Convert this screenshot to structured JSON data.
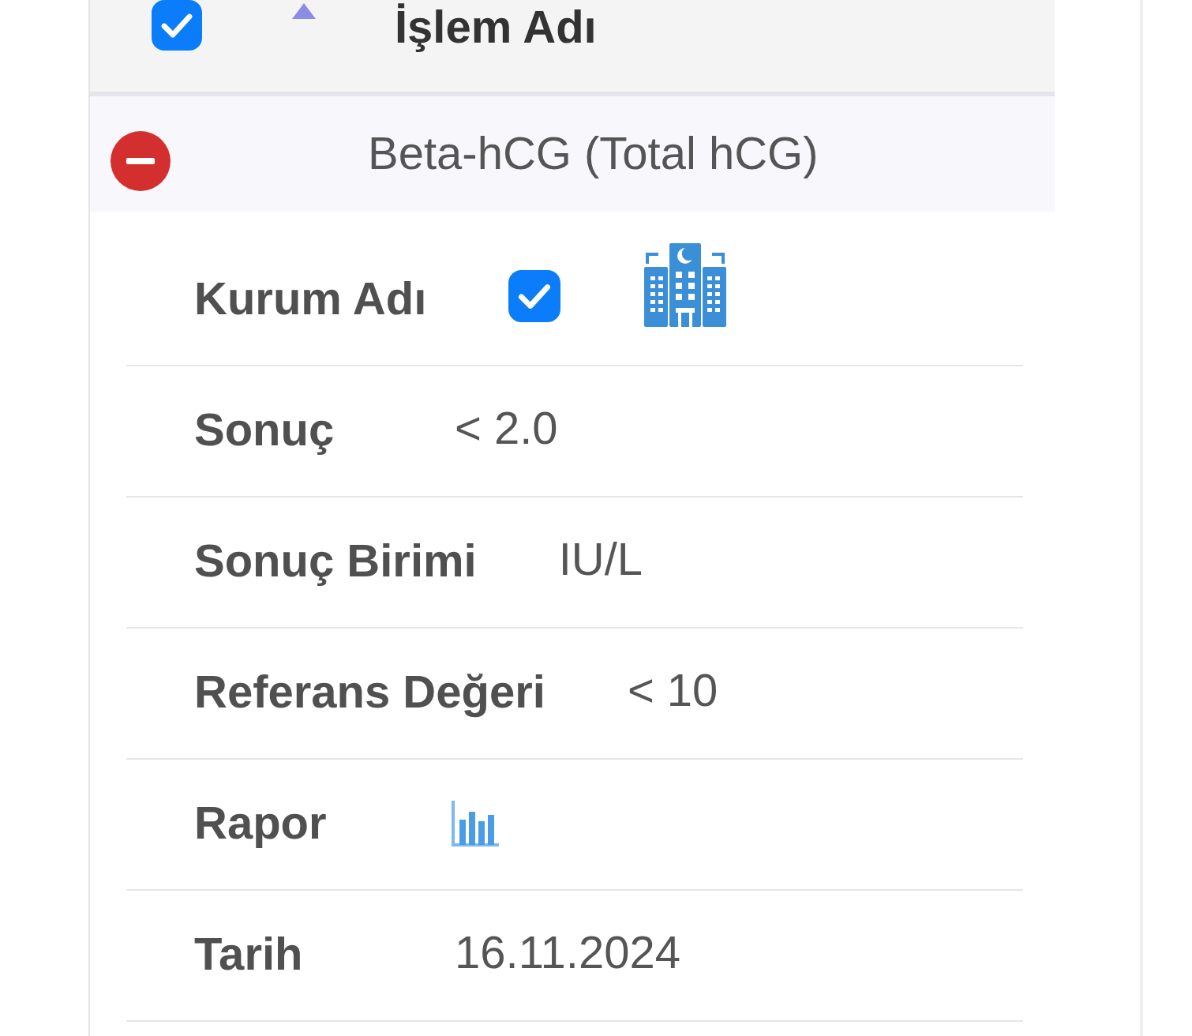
{
  "header": {
    "select_all": {
      "checked": true
    },
    "sort_ascending": true,
    "column": "İşlem Adı"
  },
  "rows": [
    {
      "expanded": true,
      "title": "Beta-hCG (Total hCG)",
      "details": [
        {
          "kind": "institution",
          "label": "Kurum Adı",
          "checked": true
        },
        {
          "kind": "text",
          "label": "Sonuç",
          "value": "< 2.0"
        },
        {
          "kind": "text",
          "label": "Sonuç Birimi",
          "value": "IU/L"
        },
        {
          "kind": "text",
          "label": "Referans Değeri",
          "value": "< 10"
        },
        {
          "kind": "report",
          "label": "Rapor"
        },
        {
          "kind": "text",
          "label": "Tarih",
          "value": "16.11.2024"
        }
      ]
    }
  ]
}
